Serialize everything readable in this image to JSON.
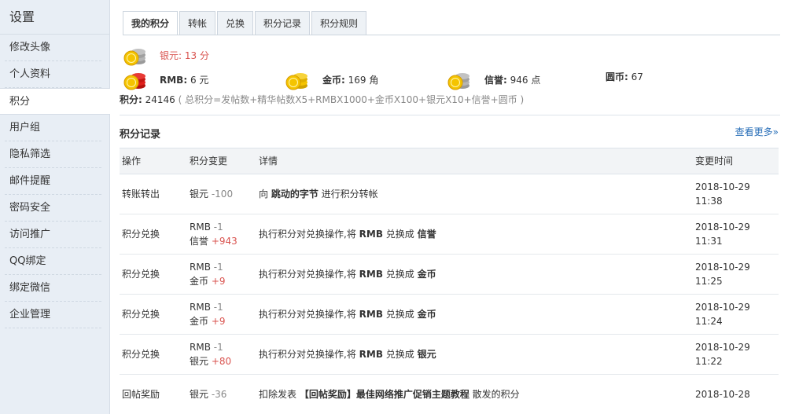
{
  "sidebar": {
    "title": "设置",
    "items": [
      {
        "label": "修改头像"
      },
      {
        "label": "个人资料"
      },
      {
        "label": "积分",
        "active": true
      },
      {
        "label": "用户组"
      },
      {
        "label": "隐私筛选"
      },
      {
        "label": "邮件提醒"
      },
      {
        "label": "密码安全"
      },
      {
        "label": "访问推广"
      },
      {
        "label": "QQ绑定"
      },
      {
        "label": "绑定微信"
      },
      {
        "label": "企业管理"
      }
    ]
  },
  "tabs": [
    {
      "label": "我的积分",
      "active": true
    },
    {
      "label": "转帐"
    },
    {
      "label": "兑换"
    },
    {
      "label": "积分记录"
    },
    {
      "label": "积分规则"
    }
  ],
  "credits": {
    "silver": {
      "name": "银元:",
      "value": "13 分"
    },
    "rmb": {
      "name": "RMB:",
      "value": "6 元"
    },
    "gold": {
      "name": "金币:",
      "value": "169 角"
    },
    "reputation": {
      "name": "信誉:",
      "value": "946 点"
    },
    "yuan": {
      "name": "圆币:",
      "value": "67"
    },
    "total": {
      "name": "积分:",
      "value": "24146",
      "formula": "( 总积分=发帖数+精华帖数X5+RMBX1000+金币X100+银元X10+信誉+圆币 )"
    }
  },
  "log": {
    "title": "积分记录",
    "more": "查看更多»",
    "headers": [
      "操作",
      "积分变更",
      "详情",
      "变更时间"
    ],
    "rows": [
      {
        "op": "转账转出",
        "changes": [
          {
            "name": "银元",
            "amt": "-100",
            "dir": "neg"
          }
        ],
        "detail": [
          "向 ",
          "跳动的字节",
          " 进行积分转帐"
        ],
        "date": "2018-10-29",
        "time": "11:38"
      },
      {
        "op": "积分兑换",
        "changes": [
          {
            "name": "RMB",
            "amt": "-1",
            "dir": "neg"
          },
          {
            "name": "信誉",
            "amt": "+943",
            "dir": "pos"
          }
        ],
        "detail": [
          "执行积分对兑换操作,将 ",
          "RMB",
          " 兑换成 ",
          "信誉"
        ],
        "date": "2018-10-29",
        "time": "11:31"
      },
      {
        "op": "积分兑换",
        "changes": [
          {
            "name": "RMB",
            "amt": "-1",
            "dir": "neg"
          },
          {
            "name": "金币",
            "amt": "+9",
            "dir": "pos"
          }
        ],
        "detail": [
          "执行积分对兑换操作,将 ",
          "RMB",
          " 兑换成 ",
          "金币"
        ],
        "date": "2018-10-29",
        "time": "11:25"
      },
      {
        "op": "积分兑换",
        "changes": [
          {
            "name": "RMB",
            "amt": "-1",
            "dir": "neg"
          },
          {
            "name": "金币",
            "amt": "+9",
            "dir": "pos"
          }
        ],
        "detail": [
          "执行积分对兑换操作,将 ",
          "RMB",
          " 兑换成 ",
          "金币"
        ],
        "date": "2018-10-29",
        "time": "11:24"
      },
      {
        "op": "积分兑换",
        "changes": [
          {
            "name": "RMB",
            "amt": "-1",
            "dir": "neg"
          },
          {
            "name": "银元",
            "amt": "+80",
            "dir": "pos"
          }
        ],
        "detail": [
          "执行积分对兑换操作,将 ",
          "RMB",
          " 兑换成 ",
          "银元"
        ],
        "date": "2018-10-29",
        "time": "11:22"
      },
      {
        "op": "回帖奖励",
        "changes": [
          {
            "name": "银元",
            "amt": "-36",
            "dir": "neg"
          }
        ],
        "detail": [
          "扣除发表 ",
          "【回帖奖励】最佳网络推广促销主题教程",
          " 散发的积分"
        ],
        "date": "2018-10-28",
        "time": ""
      }
    ]
  },
  "colors": {
    "accent_red": "#d9534f",
    "link_blue": "#2a6fb8",
    "sidebar_bg": "#e8eef5",
    "coin_gold": "#f5c400",
    "coin_silver": "#a8a8a8",
    "coin_red": "#e0201c"
  }
}
